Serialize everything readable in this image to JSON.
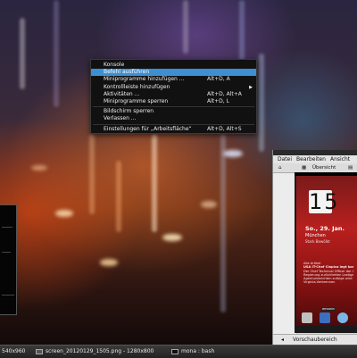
{
  "context_menu": {
    "items": [
      {
        "label": "Konsole",
        "shortcut": ""
      },
      {
        "label": "Befehl ausführen",
        "shortcut": "",
        "active": true
      },
      {
        "label": "Miniprogramme hinzufügen ...",
        "shortcut": "Alt+D, A"
      },
      {
        "label": "Kontrollleiste hinzufügen",
        "shortcut": "",
        "submenu": true
      },
      {
        "label": "Aktivitäten ...",
        "shortcut": "Alt+D, Alt+A"
      },
      {
        "label": "Miniprogramme sperren",
        "shortcut": "Alt+D, L"
      },
      {
        "label": "Bildschirm sperren",
        "shortcut": ""
      },
      {
        "label": "Verlassen ...",
        "shortcut": ""
      },
      {
        "label": "Einstellungen für „Arbeitsfläche“",
        "shortcut": "Alt+D, Alt+S"
      }
    ]
  },
  "viewer": {
    "menubar": [
      "Datei",
      "Bearbeiten",
      "Ansicht"
    ],
    "toolbar": {
      "overview": "Übersicht"
    },
    "bottom_label": "Vorschaubereich"
  },
  "phone": {
    "clock_hour": "15",
    "weather_date": "So., 29. Jan.",
    "weather_city": "München",
    "weather_condition": "Stark Bewölkt",
    "news_lines": [
      "Alle Artikel",
      "USA IT-Chef Clapica legt kostlich",
      "Der Chef Technical Officer der US-",
      "Regierung zurücktreten Lastige bei...",
      "Agenturberichten zufolge wird er seine",
      "Virginia-Verbrennen"
    ],
    "dock_badge": "amazon"
  },
  "taskbar": {
    "tasks": [
      {
        "label": "540x960"
      },
      {
        "label": "screen_20120129_1505.png - 1280x800"
      },
      {
        "label": "mona : bash"
      }
    ]
  },
  "colors": {
    "menu_highlight": "#3d8fd4",
    "menu_bg": "#111111",
    "phone_bg": "#b8201e"
  }
}
